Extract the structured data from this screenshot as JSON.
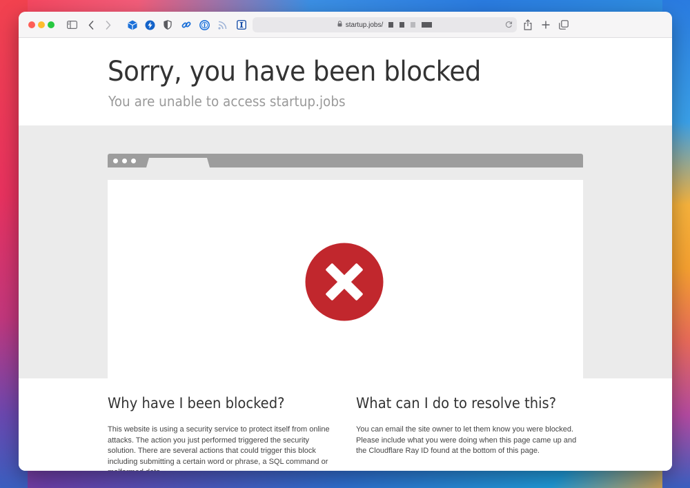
{
  "browser": {
    "url_text": "startup.jobs/",
    "icons": [
      "sidebar-icon",
      "back-icon",
      "forward-icon",
      "cube-extension-icon",
      "bolt-extension-icon",
      "shield-extension-icon",
      "link-extension-icon",
      "onepassword-extension-icon",
      "rss-extension-icon",
      "instapaper-extension-icon",
      "lock-icon",
      "reload-icon",
      "share-icon",
      "new-tab-icon",
      "tab-overview-icon"
    ]
  },
  "page": {
    "title": "Sorry, you have been blocked",
    "subtitle": "You are unable to access startup.jobs"
  },
  "sections": {
    "why": {
      "heading": "Why have I been blocked?",
      "body": "This website is using a security service to protect itself from online attacks. The action you just performed triggered the security solution. There are several actions that could trigger this block including submitting a certain word or phrase, a SQL command or malformed data."
    },
    "resolve": {
      "heading": "What can I do to resolve this?",
      "body": "You can email the site owner to let them know you were blocked. Please include what you were doing when this page came up and the Cloudflare Ray ID found at the bottom of this page."
    }
  },
  "colors": {
    "error_red": "#c1272d",
    "mock_bar": "#9d9d9d",
    "band": "#ebebeb"
  }
}
